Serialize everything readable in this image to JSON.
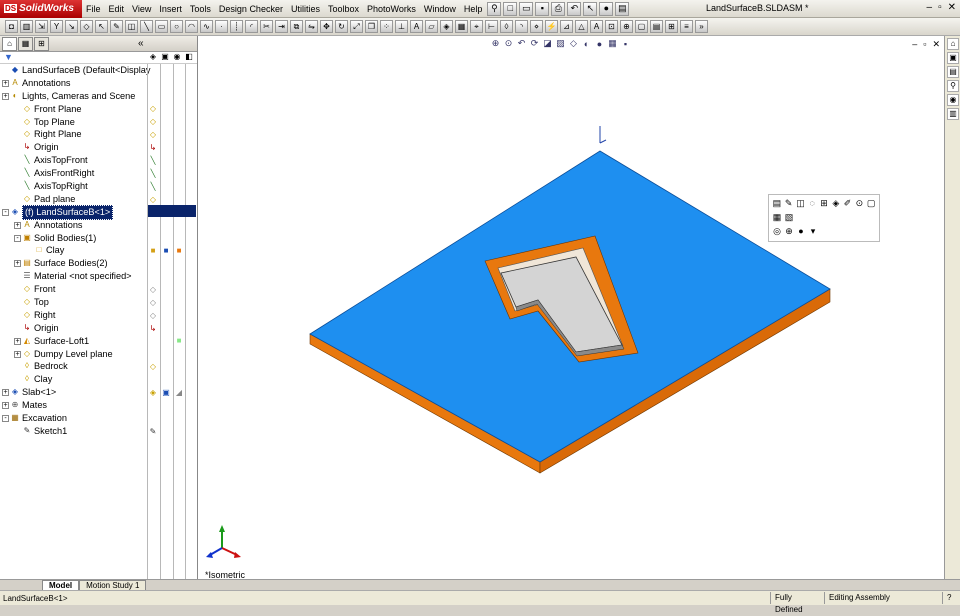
{
  "app": {
    "logo": "SolidWorks",
    "doc_title": "LandSurfaceB.SLDASM *"
  },
  "menu": [
    "File",
    "Edit",
    "View",
    "Insert",
    "Tools",
    "Design Checker",
    "Utilities",
    "Toolbox",
    "PhotoWorks",
    "Window",
    "Help"
  ],
  "tree": {
    "filter_symbol": "▼",
    "collapse_label": "«",
    "items": [
      {
        "label": "LandSurfaceB  (Default<Display",
        "icon": "assembly-icon",
        "indent": 0
      },
      {
        "label": "Annotations",
        "icon": "annotations-icon",
        "indent": 0,
        "expand": "+"
      },
      {
        "label": "Lights, Cameras and Scene",
        "icon": "lights-icon",
        "indent": 0,
        "expand": "+"
      },
      {
        "label": "Front Plane",
        "icon": "plane-icon",
        "indent": 1
      },
      {
        "label": "Top Plane",
        "icon": "plane-icon",
        "indent": 1
      },
      {
        "label": "Right Plane",
        "icon": "plane-icon",
        "indent": 1
      },
      {
        "label": "Origin",
        "icon": "origin-icon",
        "indent": 1
      },
      {
        "label": "AxisTopFront",
        "icon": "axis-icon",
        "indent": 1
      },
      {
        "label": "AxisFrontRight",
        "icon": "axis-icon",
        "indent": 1
      },
      {
        "label": "AxisTopRight",
        "icon": "axis-icon",
        "indent": 1
      },
      {
        "label": "Pad plane",
        "icon": "plane-icon",
        "indent": 1
      },
      {
        "label": "(f) LandSurfaceB<1>",
        "icon": "part-icon",
        "indent": 0,
        "expand": "-",
        "selected": true
      },
      {
        "label": "Annotations",
        "icon": "annotations-icon",
        "indent": 1,
        "expand": "+"
      },
      {
        "label": "Solid Bodies(1)",
        "icon": "solid-bodies-icon",
        "indent": 1,
        "expand": "-"
      },
      {
        "label": "Clay",
        "icon": "body-icon",
        "indent": 2
      },
      {
        "label": "Surface Bodies(2)",
        "icon": "surface-bodies-icon",
        "indent": 1,
        "expand": "+"
      },
      {
        "label": "Material <not specified>",
        "icon": "material-icon",
        "indent": 1
      },
      {
        "label": "Front",
        "icon": "plane-icon",
        "indent": 1
      },
      {
        "label": "Top",
        "icon": "plane-icon",
        "indent": 1
      },
      {
        "label": "Right",
        "icon": "plane-icon",
        "indent": 1
      },
      {
        "label": "Origin",
        "icon": "origin-icon",
        "indent": 1
      },
      {
        "label": "Surface-Loft1",
        "icon": "loft-icon",
        "indent": 1,
        "expand": "+"
      },
      {
        "label": "Dumpy Level plane",
        "icon": "plane-icon",
        "indent": 1,
        "expand": "+"
      },
      {
        "label": "Bedrock",
        "icon": "feature-icon",
        "indent": 1
      },
      {
        "label": "Clay",
        "icon": "feature-icon",
        "indent": 1
      },
      {
        "label": "Slab<1>",
        "icon": "part-icon",
        "indent": 0,
        "expand": "+"
      },
      {
        "label": "Mates",
        "icon": "mates-icon",
        "indent": 0,
        "expand": "+"
      },
      {
        "label": "Excavation",
        "icon": "excavation-icon",
        "indent": 0,
        "expand": "-"
      },
      {
        "label": "Sketch1",
        "icon": "sketch-icon",
        "indent": 1
      }
    ]
  },
  "viewport": {
    "view_label": "*Isometric"
  },
  "bottom_tabs": [
    {
      "label": "Model",
      "active": true
    },
    {
      "label": "Motion Study 1",
      "active": false
    }
  ],
  "status": {
    "selection": "LandSurfaceB<1>",
    "state": "Fully Defined",
    "mode": "Editing Assembly",
    "help": "?"
  },
  "colors": {
    "surface_top": "#1e8ff0",
    "surface_side": "#e8780e",
    "slab": "#d4d4d4",
    "selection": "#0a246a"
  }
}
